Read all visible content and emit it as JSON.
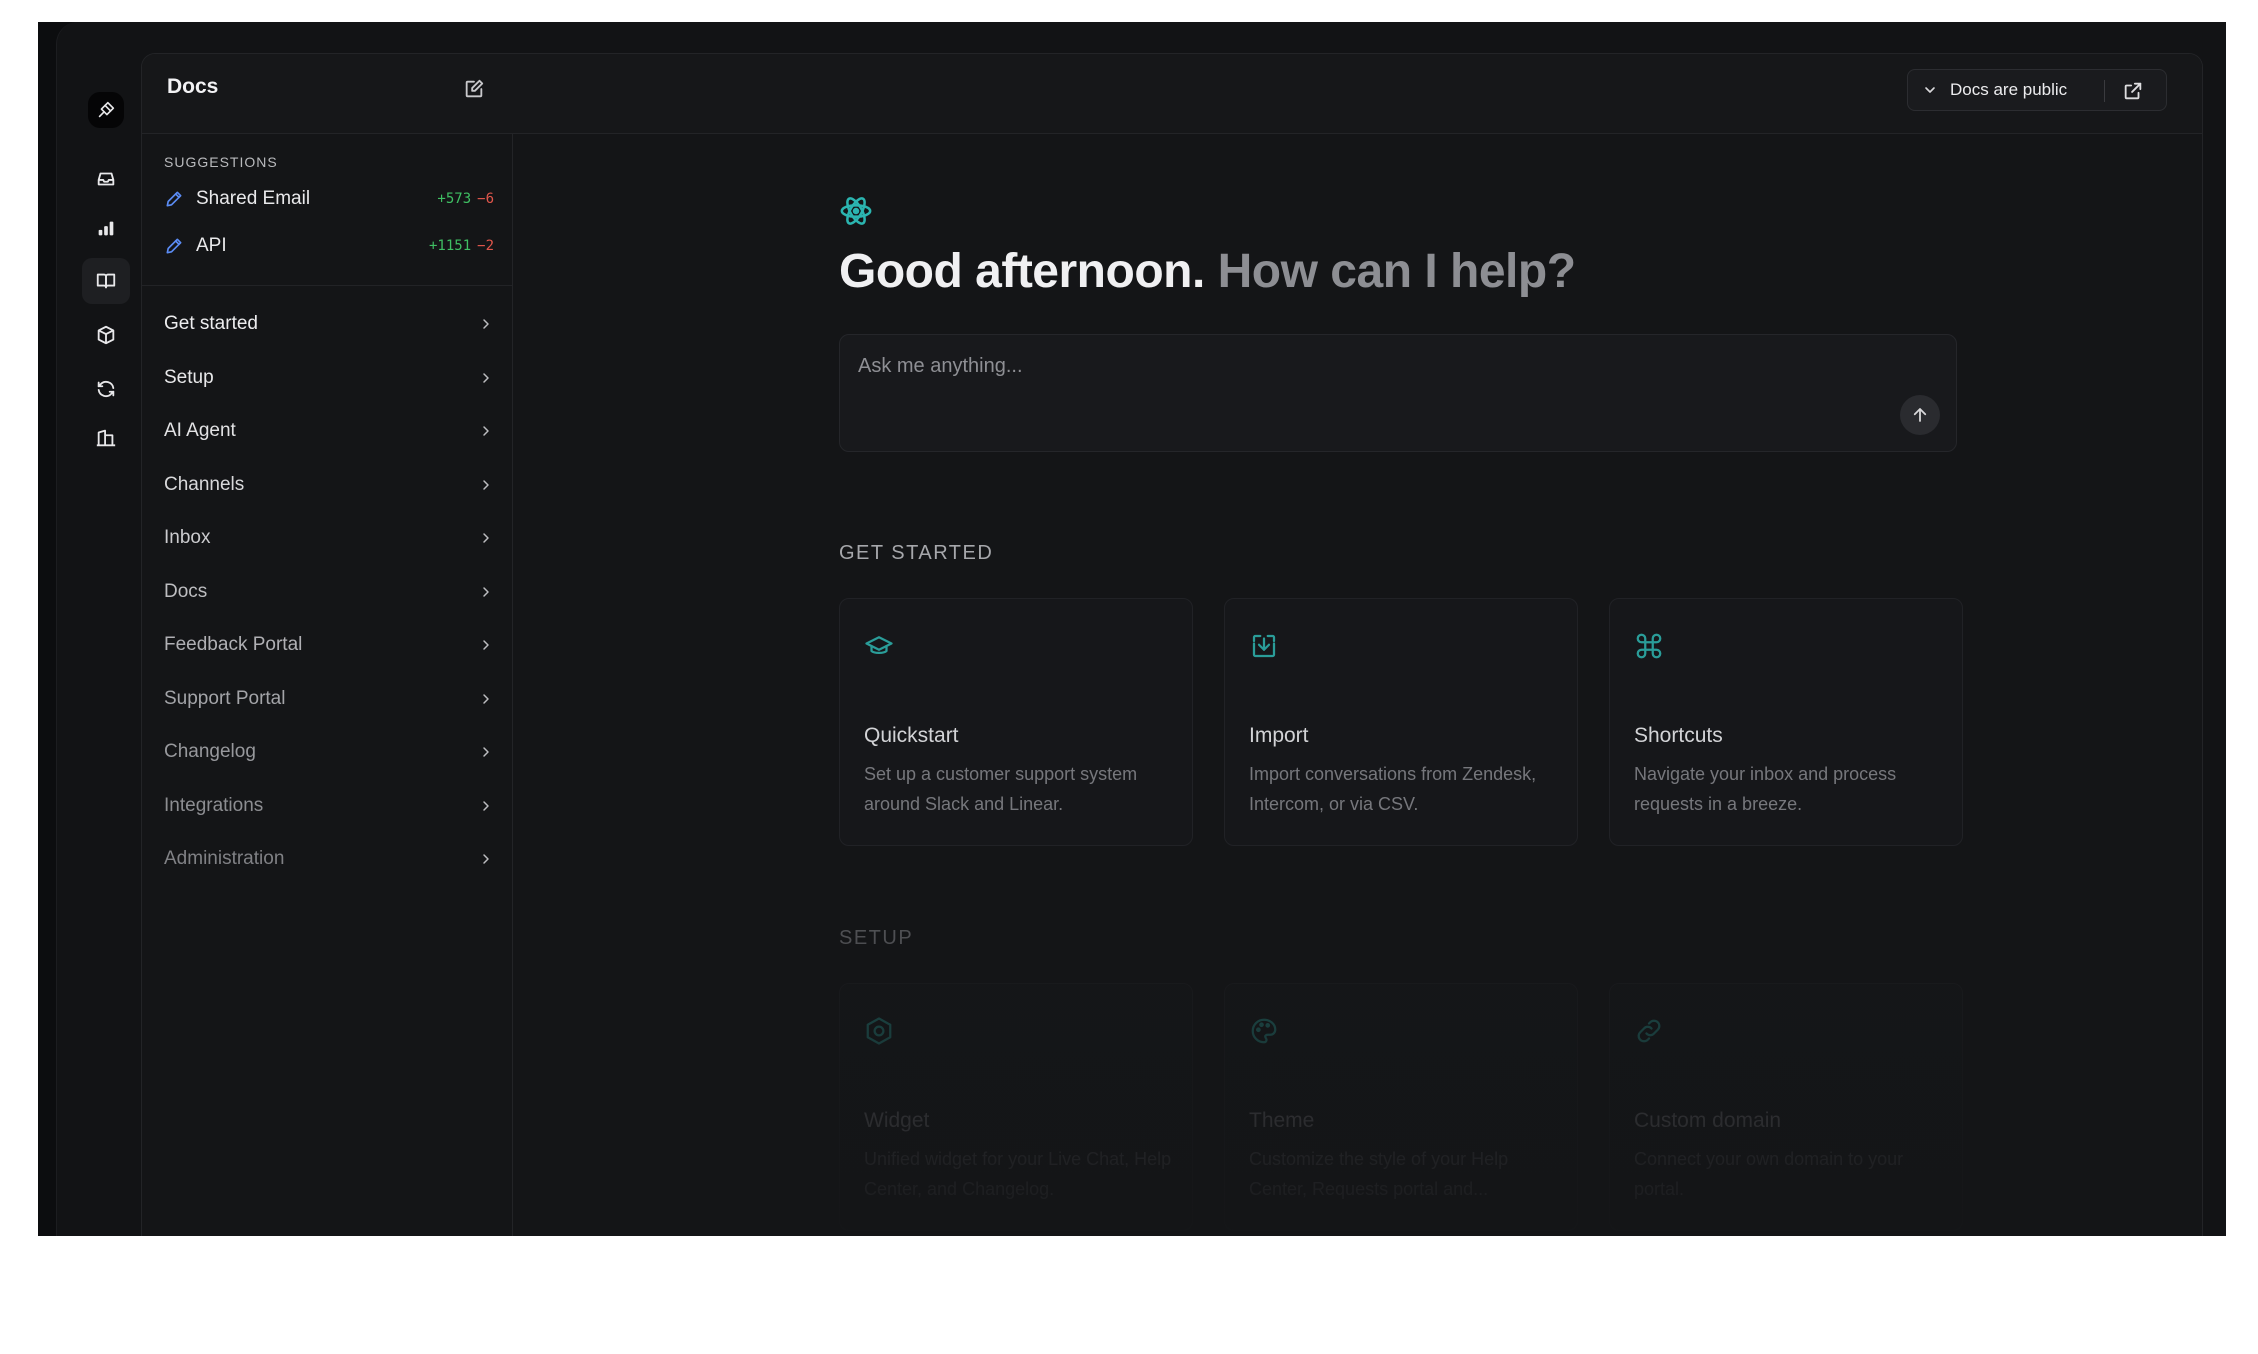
{
  "app": {
    "title": "Docs"
  },
  "header": {
    "visibility_label": "Docs are public"
  },
  "rail": {
    "icons": [
      "logo-icon",
      "inbox-icon",
      "analytics-icon",
      "docs-icon",
      "box-icon",
      "sync-icon",
      "building-icon"
    ]
  },
  "sidebar": {
    "suggestions_heading": "SUGGESTIONS",
    "suggestions": [
      {
        "name": "Shared Email",
        "added": "+573",
        "removed": "−6"
      },
      {
        "name": "API",
        "added": "+1151",
        "removed": "−2"
      }
    ],
    "nav": [
      {
        "label": "Get started"
      },
      {
        "label": "Setup"
      },
      {
        "label": "AI Agent"
      },
      {
        "label": "Channels"
      },
      {
        "label": "Inbox"
      },
      {
        "label": "Docs"
      },
      {
        "label": "Feedback Portal"
      },
      {
        "label": "Support Portal"
      },
      {
        "label": "Changelog"
      },
      {
        "label": "Integrations"
      },
      {
        "label": "Administration"
      }
    ]
  },
  "main": {
    "greeting_primary": "Good afternoon.",
    "greeting_secondary": "How can I help?",
    "ask_placeholder": "Ask me anything...",
    "get_started": {
      "heading": "GET STARTED",
      "cards": [
        {
          "icon": "graduation-cap-icon",
          "title": "Quickstart",
          "description": "Set up a customer support system around Slack and Linear."
        },
        {
          "icon": "import-icon",
          "title": "Import",
          "description": "Import conversations from Zendesk, Intercom, or via CSV."
        },
        {
          "icon": "command-icon",
          "title": "Shortcuts",
          "description": "Navigate your inbox and process requests in a breeze."
        }
      ]
    },
    "setup": {
      "heading": "SETUP",
      "cards": [
        {
          "icon": "widget-icon",
          "title": "Widget",
          "description": "Unified widget for your Live Chat, Help Center, and Changelog."
        },
        {
          "icon": "palette-icon",
          "title": "Theme",
          "description": "Customize the style of your Help Center, Requests portal and..."
        },
        {
          "icon": "link-icon",
          "title": "Custom domain",
          "description": "Connect your own domain to your portal."
        }
      ]
    }
  },
  "colors": {
    "accent": "#2bb5b0",
    "positive": "#3fbf63",
    "negative": "#e0564b",
    "pen": "#5b8cf5"
  }
}
